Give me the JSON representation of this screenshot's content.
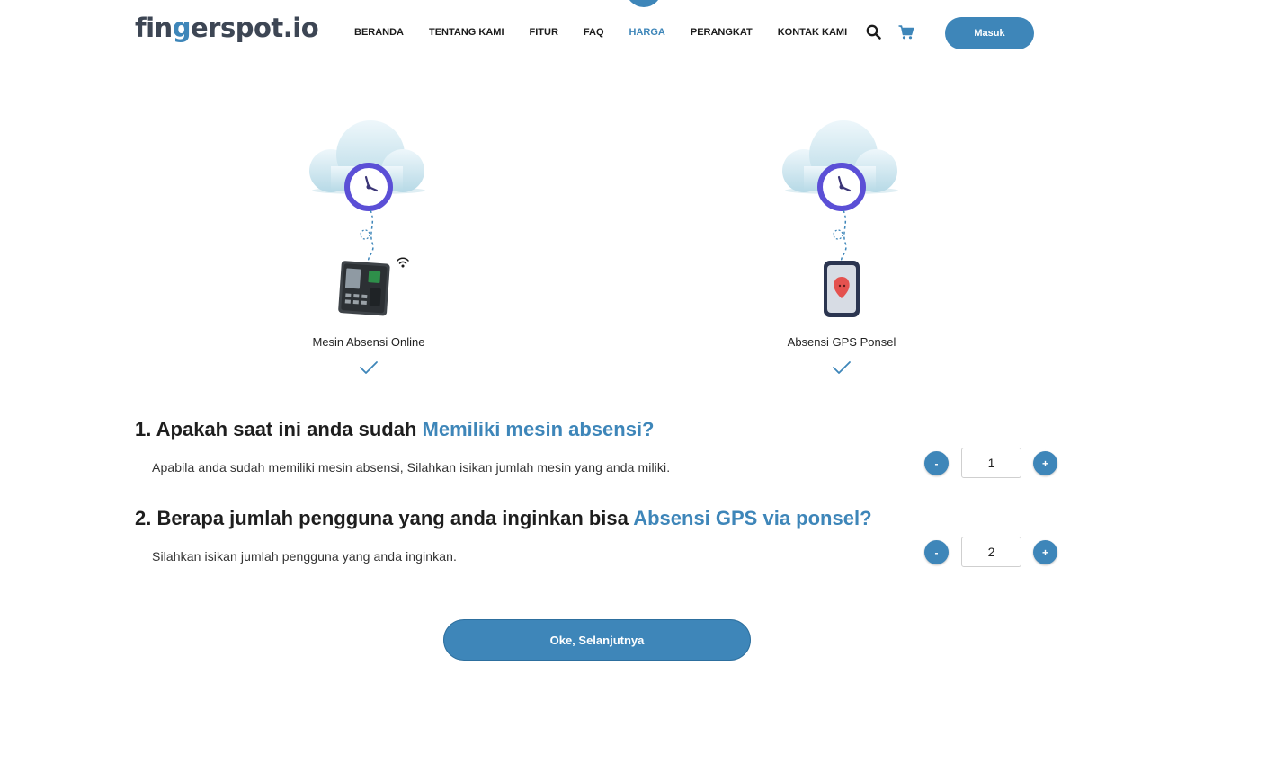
{
  "header": {
    "logo": {
      "part1": "fin",
      "part2": "g",
      "part3": "erspot.io"
    },
    "nav": [
      {
        "label": "BERANDA",
        "active": false
      },
      {
        "label": "TENTANG KAMI",
        "active": false
      },
      {
        "label": "FITUR",
        "active": false
      },
      {
        "label": "FAQ",
        "active": false
      },
      {
        "label": "HARGA",
        "active": true
      },
      {
        "label": "PERANGKAT",
        "active": false
      },
      {
        "label": "KONTAK KAMI",
        "active": false
      }
    ],
    "icons": {
      "search": "search-icon",
      "cart": "cart-icon"
    },
    "login_label": "Masuk"
  },
  "options": [
    {
      "label": "Mesin Absensi Online",
      "selected": true,
      "icon": "attendance-machine-icon"
    },
    {
      "label": "Absensi GPS Ponsel",
      "selected": true,
      "icon": "gps-phone-icon"
    }
  ],
  "questions": [
    {
      "title_prefix": "1. Apakah saat ini anda sudah ",
      "title_highlight": "Memiliki mesin absensi?",
      "description": "Apabila anda sudah memiliki mesin absensi, Silahkan isikan jumlah mesin yang anda miliki.",
      "value": "1",
      "minus": "-",
      "plus": "+"
    },
    {
      "title_prefix": "2. Berapa jumlah pengguna yang anda inginkan bisa ",
      "title_highlight": "Absensi GPS via ponsel?",
      "description": "Silahkan isikan jumlah pengguna yang anda inginkan.",
      "value": "2",
      "minus": "-",
      "plus": "+"
    }
  ],
  "next_label": "Oke, Selanjutnya",
  "colors": {
    "accent": "#3e86b9",
    "text": "#1e1e1e",
    "clock": "#5b4fd6"
  }
}
